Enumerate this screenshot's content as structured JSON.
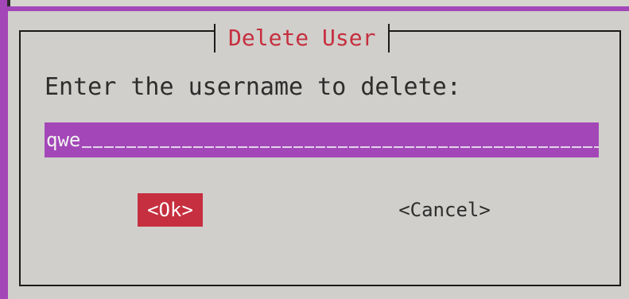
{
  "dialog": {
    "title": "Delete User",
    "prompt": "Enter the username to delete:",
    "input": {
      "value": "qwe"
    },
    "buttons": {
      "ok_label": "<Ok>",
      "cancel_label": "<Cancel>"
    }
  },
  "colors": {
    "background": "#a347b8",
    "dialog_background": "#d0cfcb",
    "title": "#c62f3f",
    "selected_button": "#c62f3f",
    "input_background": "#a347b8",
    "text": "#2d2d2d"
  }
}
